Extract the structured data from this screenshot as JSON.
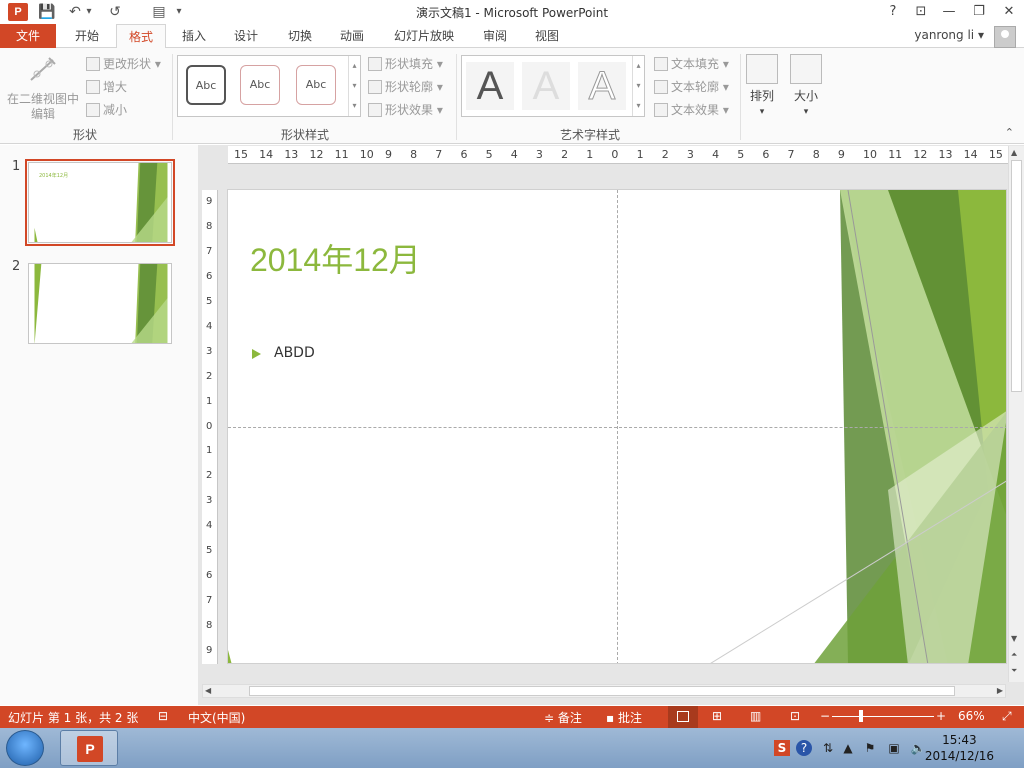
{
  "window": {
    "title": "演示文稿1 - Microsoft PowerPoint",
    "app_icon": "P",
    "help": "?",
    "restore_ribbon": "⊡",
    "minimize": "—",
    "maximize": "❐",
    "close": "✕"
  },
  "qat": {
    "save": "💾",
    "undo": "↶",
    "undo_drop": "▾",
    "redo": "↺",
    "layout": "▤",
    "customize": "▾"
  },
  "tabs": {
    "file": "文件",
    "items": [
      "开始",
      "格式",
      "插入",
      "设计",
      "切换",
      "动画",
      "幻灯片放映",
      "审阅",
      "视图"
    ],
    "active_index": 1
  },
  "user": {
    "name": "yanrong li",
    "drop": "▾"
  },
  "ribbon": {
    "shape_group": {
      "label": "形状",
      "edit_3d": "在二维视图中编辑",
      "change_shape": "更改形状",
      "enlarge": "增大",
      "shrink": "减小"
    },
    "shape_styles": {
      "label": "形状样式",
      "styles": [
        "Abc",
        "Abc",
        "Abc"
      ],
      "fill": "形状填充",
      "outline": "形状轮廓",
      "effects": "形状效果"
    },
    "wordart": {
      "label": "艺术字样式",
      "styles": [
        "A",
        "A",
        "A"
      ],
      "text_fill": "文本填充",
      "text_outline": "文本轮廓",
      "text_effects": "文本效果"
    },
    "arrange": "排列",
    "size": "大小",
    "collapse": "⌃"
  },
  "slides": {
    "numbers": [
      "1",
      "2"
    ],
    "thumb1_title": "2014年12月"
  },
  "slide": {
    "title": "2014年12月",
    "bullet": "ABDD"
  },
  "ruler": {
    "h_ticks": [
      "15",
      "14",
      "13",
      "12",
      "11",
      "10",
      "9",
      "8",
      "7",
      "6",
      "5",
      "4",
      "3",
      "2",
      "1",
      "0",
      "1",
      "2",
      "3",
      "4",
      "5",
      "6",
      "7",
      "8",
      "9",
      "10",
      "11",
      "12",
      "13",
      "14",
      "15"
    ],
    "v_ticks": [
      "9",
      "8",
      "7",
      "6",
      "5",
      "4",
      "3",
      "2",
      "1",
      "0",
      "1",
      "2",
      "3",
      "4",
      "5",
      "6",
      "7",
      "8",
      "9"
    ]
  },
  "statusbar": {
    "slide_info": "幻灯片 第 1 张，共 2 张",
    "language": "中文(中国)",
    "notes": "备注",
    "comments": "批注",
    "zoom_minus": "−",
    "zoom_plus": "+",
    "zoom": "66%",
    "fit": "⤢"
  },
  "taskbar": {
    "time": "15:43",
    "date": "2014/12/16",
    "ppt": "P"
  },
  "colors": {
    "accent": "#d24726",
    "slide_green": "#8cb83d",
    "dark_green": "#5a8a34"
  }
}
